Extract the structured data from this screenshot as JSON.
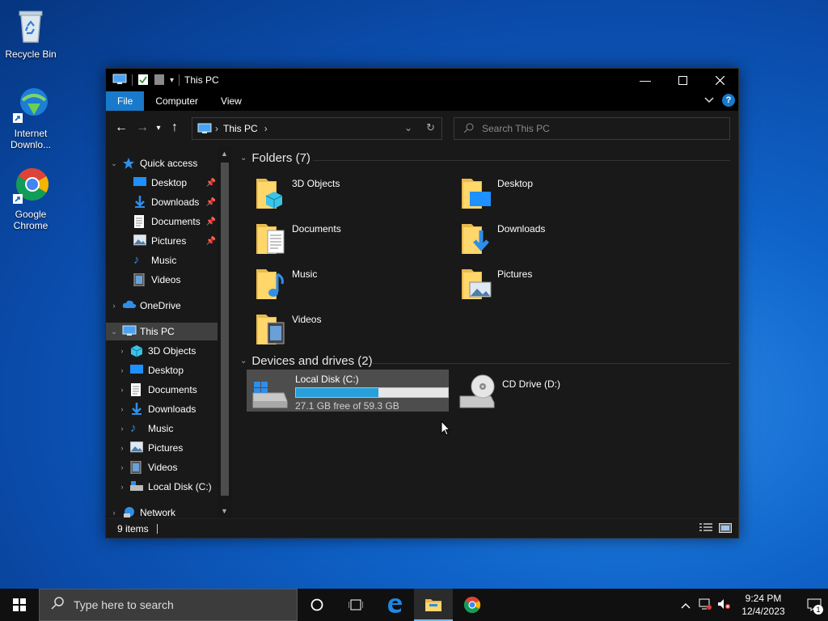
{
  "desktop": {
    "icons": [
      {
        "label": "Recycle Bin",
        "icon": "recycle-bin-icon"
      },
      {
        "label": "Internet Downlo...",
        "icon": "internet-download-manager-icon"
      },
      {
        "label": "Google Chrome",
        "icon": "chrome-icon"
      }
    ]
  },
  "window": {
    "title": "This PC",
    "ribbon_tabs": [
      "File",
      "Computer",
      "View"
    ],
    "help_label": "?",
    "address": {
      "crumb": "This PC"
    },
    "search": {
      "placeholder": "Search This PC"
    }
  },
  "nav_pane": {
    "quick_access": "Quick access",
    "quick_items": [
      "Desktop",
      "Downloads",
      "Documents",
      "Pictures",
      "Music",
      "Videos"
    ],
    "onedrive": "OneDrive",
    "this_pc": "This PC",
    "pc_items": [
      "3D Objects",
      "Desktop",
      "Documents",
      "Downloads",
      "Music",
      "Pictures",
      "Videos",
      "Local Disk (C:)"
    ],
    "network": "Network"
  },
  "content": {
    "folders_header": "Folders (7)",
    "folders": [
      "3D Objects",
      "Desktop",
      "Documents",
      "Downloads",
      "Music",
      "Pictures",
      "Videos"
    ],
    "devices_header": "Devices and drives (2)",
    "drives": [
      {
        "name": "Local Disk (C:)",
        "free_text": "27.1 GB free of 59.3 GB",
        "used_fraction": 0.543
      },
      {
        "name": "CD Drive (D:)"
      }
    ]
  },
  "status": {
    "items": "9 items"
  },
  "taskbar": {
    "search_placeholder": "Type here to search",
    "time": "9:24 PM",
    "date": "12/4/2023",
    "notification_count": "1"
  },
  "colors": {
    "accent": "#1979ca",
    "drive_bar": "#26a0da",
    "desktop": "#0f63c9"
  }
}
